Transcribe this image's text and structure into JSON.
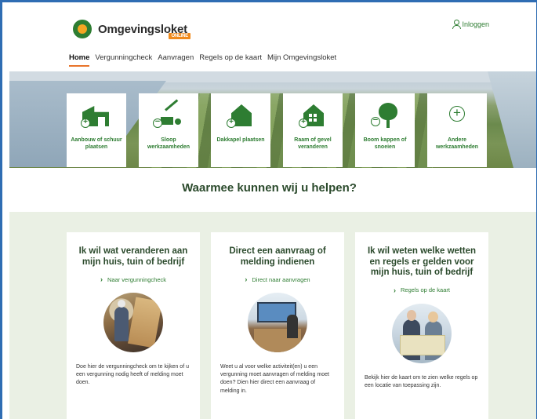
{
  "header": {
    "logo_text": "Omgevingsloket",
    "logo_badge": "ONLINE",
    "login_label": "Inloggen"
  },
  "nav": {
    "items": [
      {
        "label": "Home",
        "active": true
      },
      {
        "label": "Vergunningcheck",
        "active": false
      },
      {
        "label": "Aanvragen",
        "active": false
      },
      {
        "label": "Regels op de kaart",
        "active": false
      },
      {
        "label": "Mijn Omgevingsloket",
        "active": false
      }
    ]
  },
  "tiles": [
    {
      "label": "Aanbouw of schuur plaatsen",
      "icon": "shed-plus-icon"
    },
    {
      "label": "Sloop werkzaamheden",
      "icon": "crane-icon"
    },
    {
      "label": "Dakkapel plaatsen",
      "icon": "house-plus-icon"
    },
    {
      "label": "Raam of gevel veranderen",
      "icon": "house-window-icon"
    },
    {
      "label": "Boom kappen of snoeien",
      "icon": "tree-minus-icon"
    },
    {
      "label": "Andere werkzaamheden",
      "icon": "plus-circle-icon"
    }
  ],
  "question": "Waarmee kunnen wij u helpen?",
  "cards": [
    {
      "title": "Ik wil wat veranderen aan mijn huis, tuin of bedrijf",
      "link": "Naar vergunningcheck",
      "text": "Doe hier de vergunningcheck om te kijken of u een vergunning nodig heeft of melding moet doen."
    },
    {
      "title": "Direct een aanvraag of melding indienen",
      "link": "Direct naar aanvragen",
      "text": "Weet u al voor welke activiteit(en) u een vergunning moet aanvragen of melding moet doen? Dien hier direct een aanvraag of melding in."
    },
    {
      "title": "Ik wil weten welke wetten en regels er gelden voor mijn huis, tuin of bedrijf",
      "link": "Regels op de kaart",
      "text": "Bekijk hier de kaart om te zien welke regels op een locatie van toepassing zijn."
    }
  ],
  "colors": {
    "brand_green": "#2e7d32",
    "accent_orange": "#e8742a",
    "section_bg": "#eaf0e4"
  }
}
